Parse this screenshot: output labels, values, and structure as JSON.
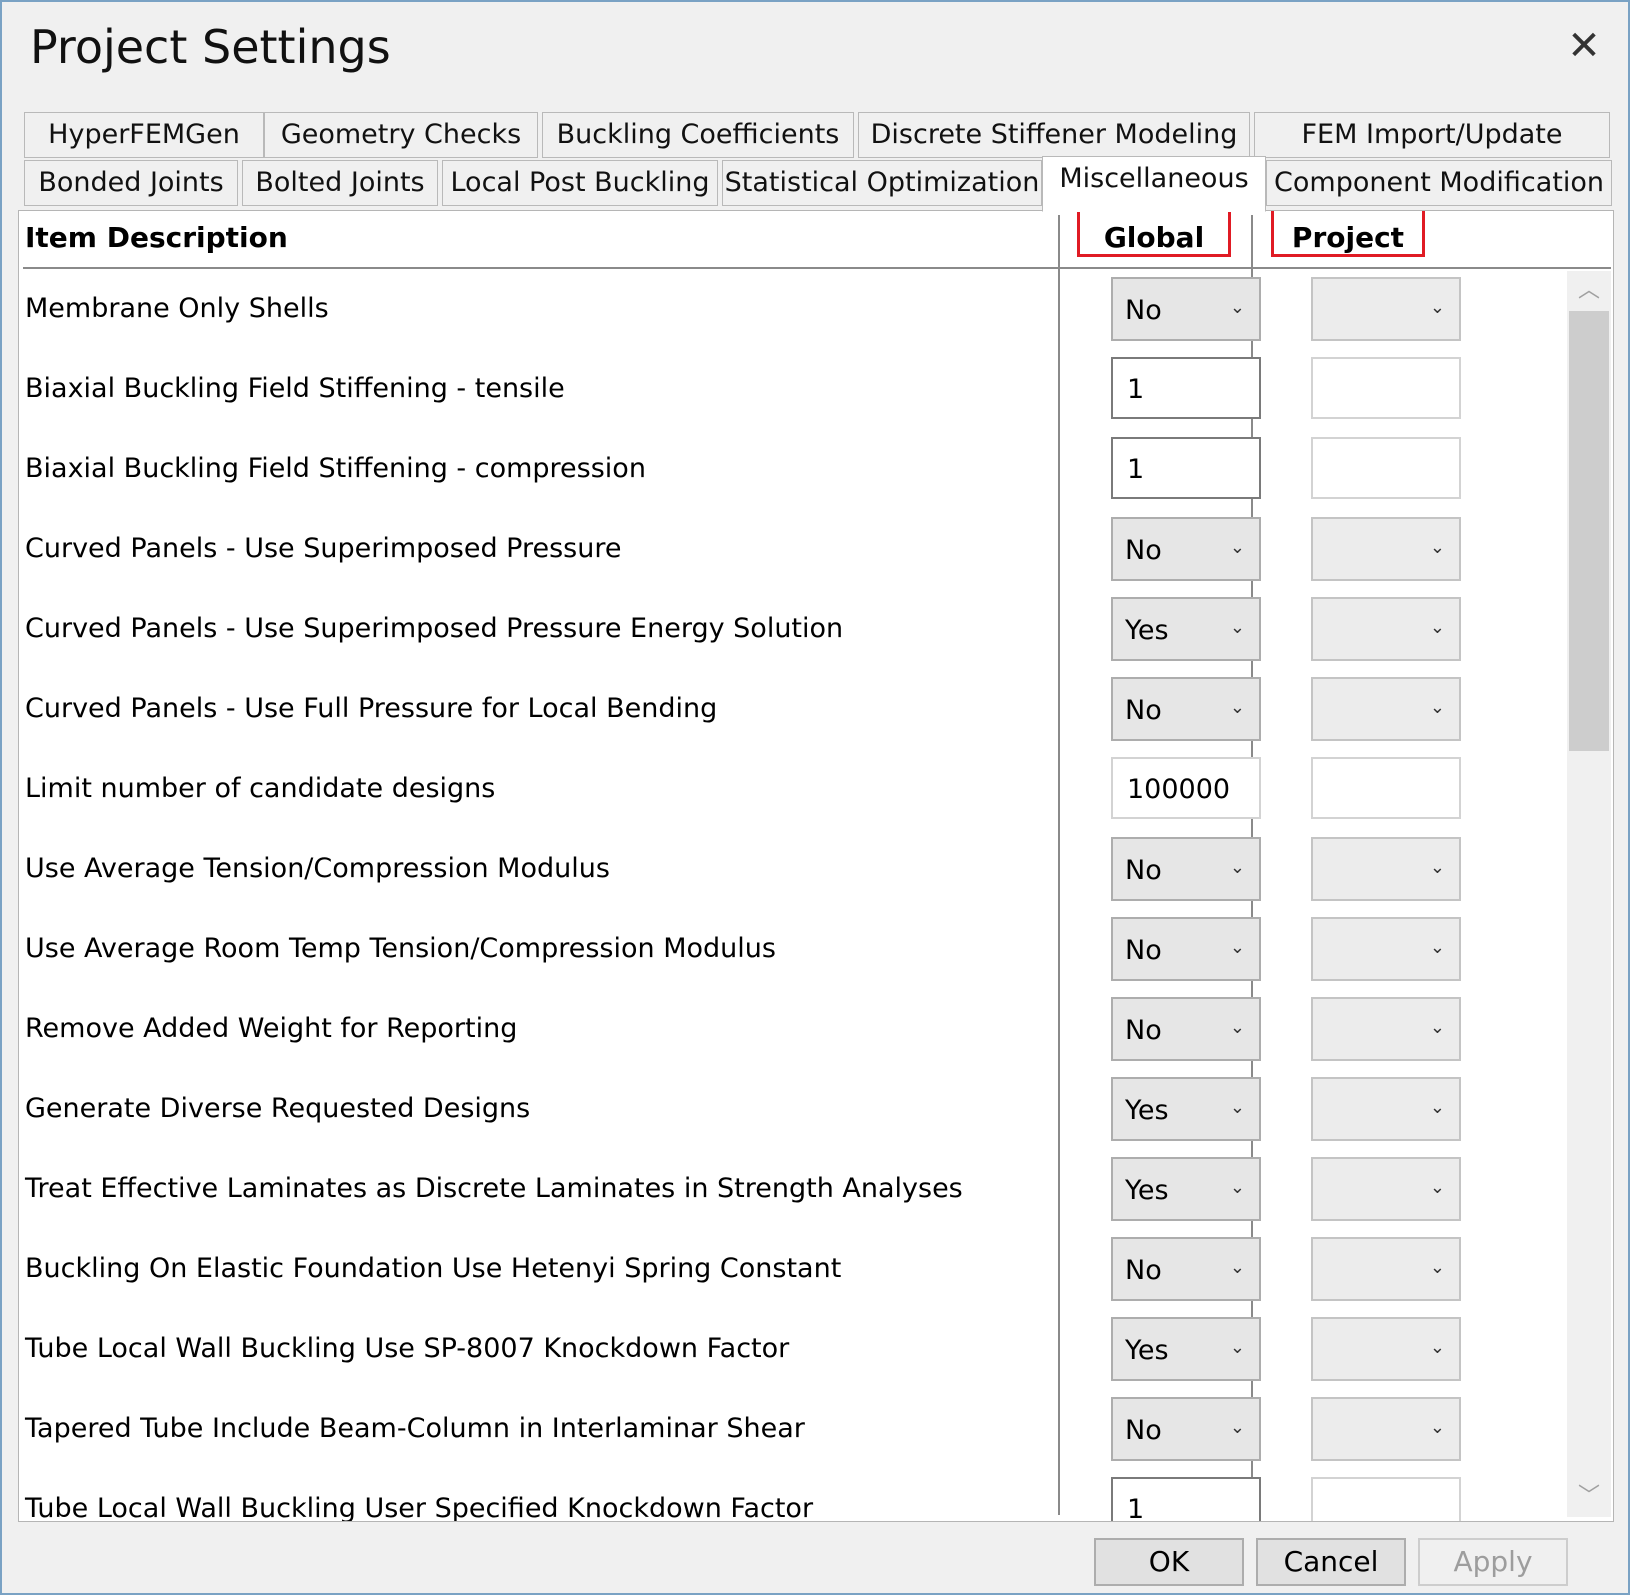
{
  "window": {
    "title": "Project Settings"
  },
  "tabs_row1": [
    "HyperFEMGen",
    "Geometry Checks",
    "Buckling Coefficients",
    "Discrete Stiffener Modeling",
    "FEM Import/Update"
  ],
  "tabs_row2": [
    "Bonded Joints",
    "Bolted Joints",
    "Local Post Buckling",
    "Statistical Optimization",
    "Miscellaneous",
    "Component Modification"
  ],
  "active_tab": "Miscellaneous",
  "columns": {
    "description": "Item Description",
    "global": "Global",
    "project": "Project"
  },
  "highlight_color": "#e01b24",
  "rows": [
    {
      "label": "Membrane Only Shells",
      "type": "combo",
      "global": "No",
      "project": ""
    },
    {
      "label": "Biaxial Buckling Field Stiffening - tensile",
      "type": "text",
      "global": "1",
      "project": ""
    },
    {
      "label": "Biaxial Buckling Field Stiffening - compression",
      "type": "text",
      "global": "1",
      "project": ""
    },
    {
      "label": "Curved Panels - Use Superimposed Pressure",
      "type": "combo",
      "global": "No",
      "project": ""
    },
    {
      "label": "Curved Panels - Use Superimposed Pressure Energy Solution",
      "type": "combo",
      "global": "Yes",
      "project": ""
    },
    {
      "label": "Curved Panels - Use Full Pressure for Local Bending",
      "type": "combo",
      "global": "No",
      "project": ""
    },
    {
      "label": "Limit number of candidate designs",
      "type": "text",
      "global": "100000",
      "project": ""
    },
    {
      "label": "Use Average Tension/Compression Modulus",
      "type": "combo",
      "global": "No",
      "project": ""
    },
    {
      "label": "Use Average Room Temp Tension/Compression Modulus",
      "type": "combo",
      "global": "No",
      "project": ""
    },
    {
      "label": "Remove Added Weight for Reporting",
      "type": "combo",
      "global": "No",
      "project": ""
    },
    {
      "label": "Generate Diverse Requested Designs",
      "type": "combo",
      "global": "Yes",
      "project": ""
    },
    {
      "label": "Treat Effective Laminates as Discrete Laminates in Strength Analyses",
      "type": "combo",
      "global": "Yes",
      "project": ""
    },
    {
      "label": "Buckling On Elastic Foundation Use Hetenyi Spring Constant",
      "type": "combo",
      "global": "No",
      "project": ""
    },
    {
      "label": "Tube Local Wall Buckling Use SP-8007 Knockdown Factor",
      "type": "combo",
      "global": "Yes",
      "project": ""
    },
    {
      "label": "Tapered Tube Include Beam-Column in Interlaminar Shear",
      "type": "combo",
      "global": "No",
      "project": ""
    },
    {
      "label": "Tube Local Wall Buckling User Specified Knockdown Factor",
      "type": "text",
      "global": "1",
      "project": ""
    }
  ],
  "buttons": {
    "ok": "OK",
    "cancel": "Cancel",
    "apply": "Apply"
  },
  "icons": {
    "close": "close-icon",
    "dropdown": "chevron-down-icon",
    "scroll_up": "chevron-up-icon",
    "scroll_down": "chevron-down-icon"
  }
}
